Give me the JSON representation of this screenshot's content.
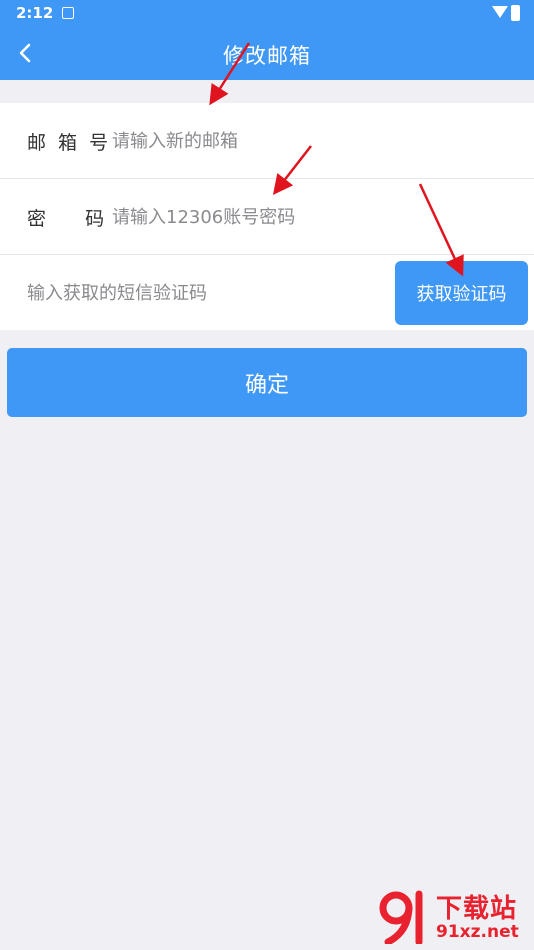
{
  "status_bar": {
    "time": "2:12"
  },
  "app_bar": {
    "title": "修改邮箱"
  },
  "form": {
    "email": {
      "label": "邮 箱 号",
      "placeholder": "请输入新的邮箱"
    },
    "password": {
      "label": "密    码",
      "placeholder": "请输入12306账号密码"
    },
    "sms_code": {
      "placeholder": "输入获取的短信验证码",
      "button_label": "获取验证码"
    }
  },
  "confirm_label": "确定",
  "colors": {
    "primary": "#3f97f6",
    "background": "#efeff4",
    "annotation_arrow": "#e0141e"
  },
  "watermark": {
    "cn": "下载站",
    "en": "91xz.net"
  }
}
